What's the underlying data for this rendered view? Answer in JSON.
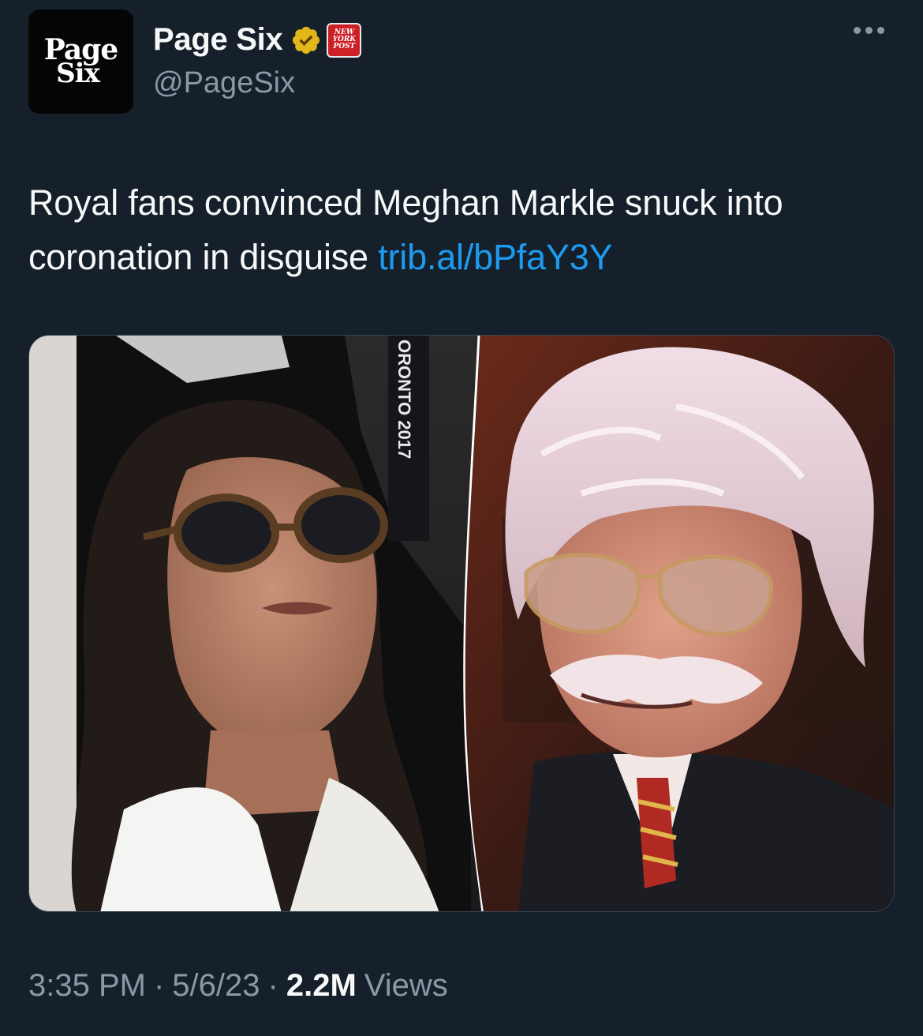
{
  "author": {
    "avatar_text_line1": "Page",
    "avatar_text_line2": "Six",
    "display_name": "Page Six",
    "handle": "@PageSix",
    "affiliate_badge_text": [
      "NEW",
      "YORK",
      "POST"
    ]
  },
  "tweet": {
    "text": "Royal fans convinced Meghan Markle snuck into coronation in disguise",
    "link": "trib.al/bPfaY3Y"
  },
  "media": {
    "overlay_text": "ORONTO 2017"
  },
  "meta": {
    "time": "3:35 PM",
    "date": "5/6/23",
    "views_count": "2.2M",
    "views_label": "Views"
  },
  "colors": {
    "background": "#15202b",
    "link": "#1d9bf0",
    "verified_gold": "#e2b719",
    "secondary_text": "#8b98a5"
  },
  "icons": [
    "verified-badge-icon",
    "more-options-icon"
  ]
}
